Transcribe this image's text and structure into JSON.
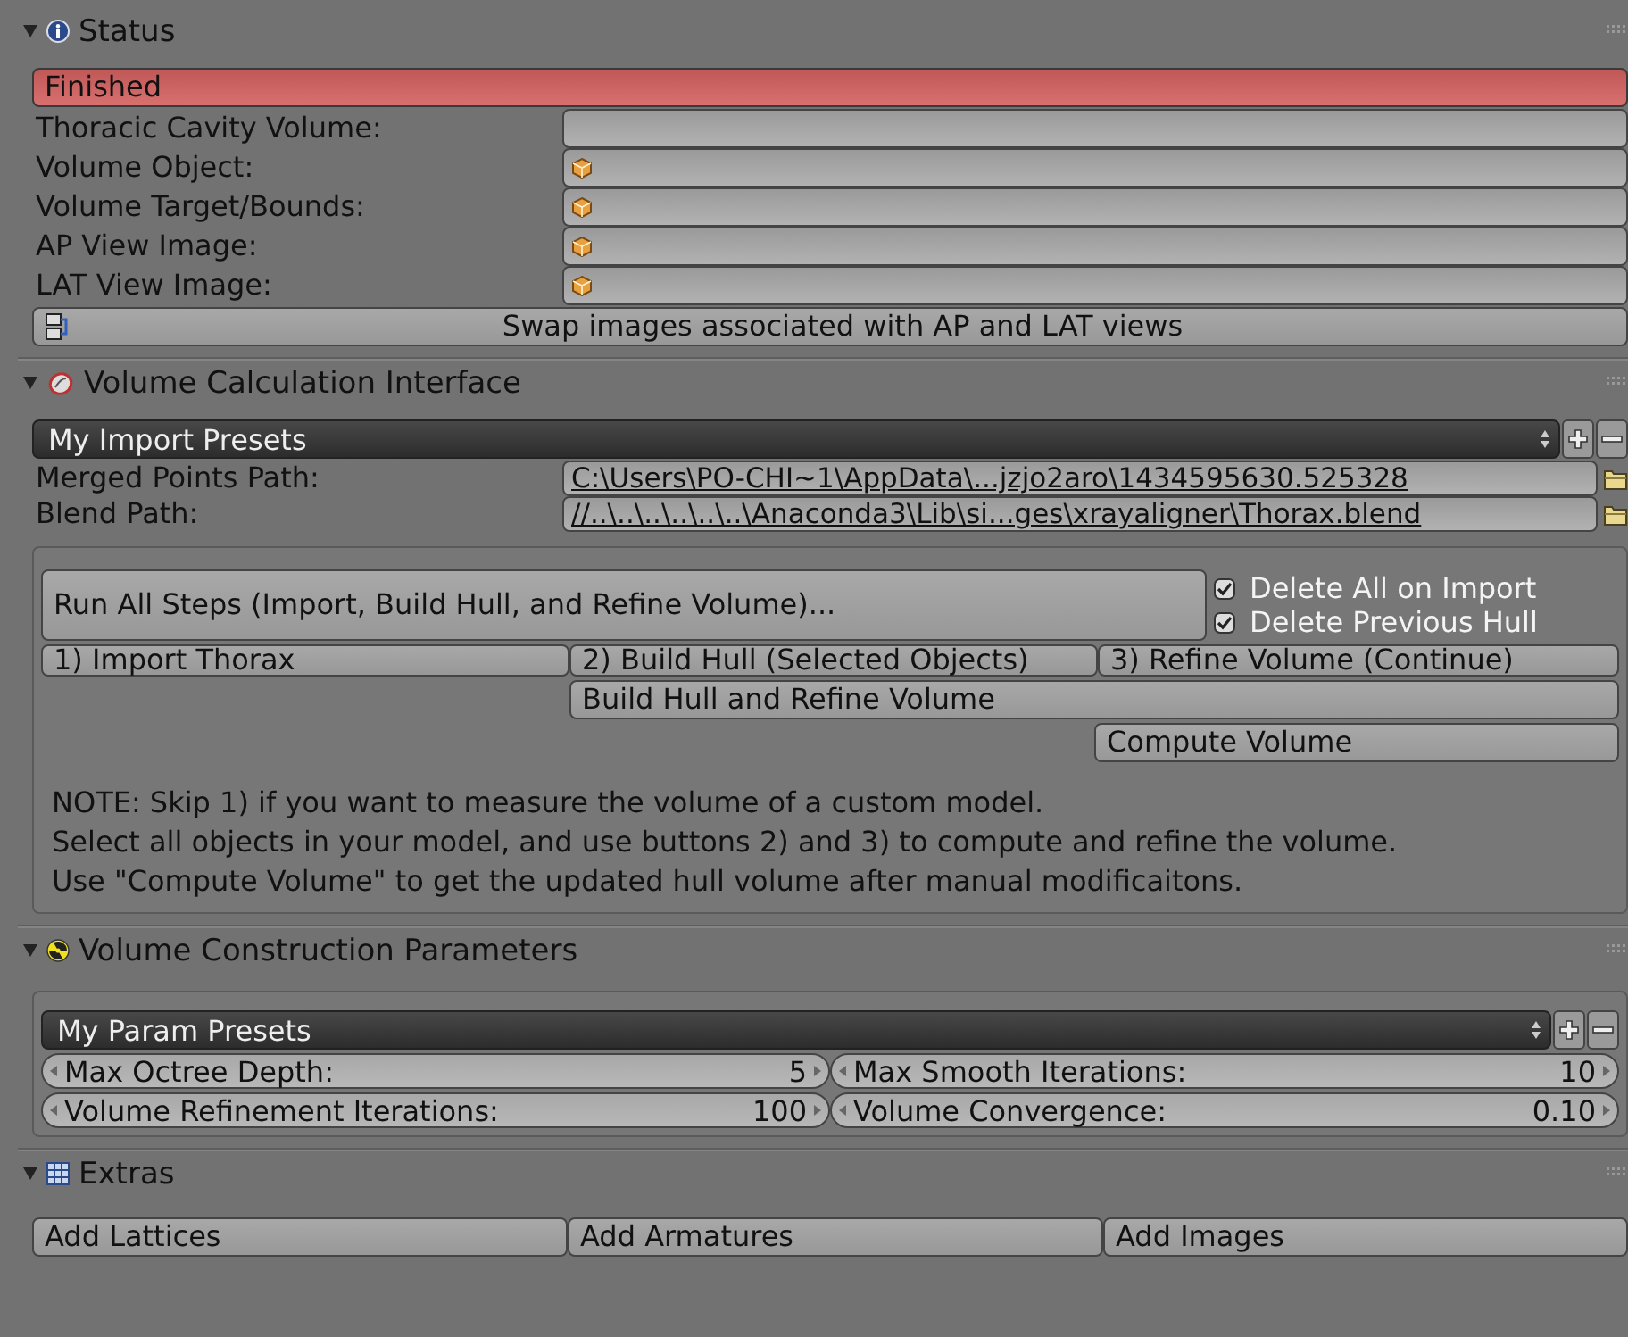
{
  "status_panel": {
    "title": "Status",
    "expanded": true,
    "status": "Finished",
    "fields": [
      {
        "label": "Thoracic Cavity Volume:",
        "kind": "text"
      },
      {
        "label": "Volume Object:",
        "kind": "object"
      },
      {
        "label": "Volume Target/Bounds:",
        "kind": "object"
      },
      {
        "label": "AP View Image:",
        "kind": "object"
      },
      {
        "label": "LAT View Image:",
        "kind": "object"
      }
    ],
    "swap_button": "Swap images associated with AP and LAT views"
  },
  "volume_calculation_panel": {
    "title": "Volume Calculation Interface",
    "expanded": true,
    "preset": "My Import Presets",
    "paths": [
      {
        "label": "Merged Points Path:",
        "value": "C:\\Users\\PO-CHI~1\\AppData\\...jzjo2aro\\1434595630.525328"
      },
      {
        "label": "Blend Path:",
        "value": "//..\\..\\..\\..\\..\\..\\Anaconda3\\Lib\\si...ges\\xrayaligner\\Thorax.blend"
      }
    ],
    "run_all_button": "Run All Steps (Import, Build Hull, and Refine Volume)...",
    "checkboxes": [
      {
        "label": "Delete All on Import",
        "checked": true
      },
      {
        "label": "Delete Previous Hull",
        "checked": true
      }
    ],
    "step_buttons": [
      "1) Import Thorax",
      "2) Build Hull (Selected Objects)",
      "3) Refine Volume (Continue)"
    ],
    "build_refine_button": "Build Hull and Refine Volume",
    "compute_button": "Compute Volume",
    "notes": [
      "NOTE: Skip 1) if you want to measure the volume of a custom model.",
      "Select all objects in your model, and use buttons 2) and 3) to compute and refine the volume.",
      "Use \"Compute Volume\" to get the updated hull volume after manual modificaitons."
    ]
  },
  "construction_panel": {
    "title": "Volume Construction Parameters",
    "expanded": true,
    "preset": "My Param Presets",
    "parameters": [
      {
        "label": "Max Octree Depth:",
        "value": "5"
      },
      {
        "label": "Max Smooth Iterations:",
        "value": "10"
      },
      {
        "label": "Volume Refinement Iterations:",
        "value": "100"
      },
      {
        "label": "Volume Convergence:",
        "value": "0.10"
      }
    ]
  },
  "extras_panel": {
    "title": "Extras",
    "expanded": true,
    "buttons": [
      "Add Lattices",
      "Add Armatures",
      "Add Images"
    ]
  }
}
